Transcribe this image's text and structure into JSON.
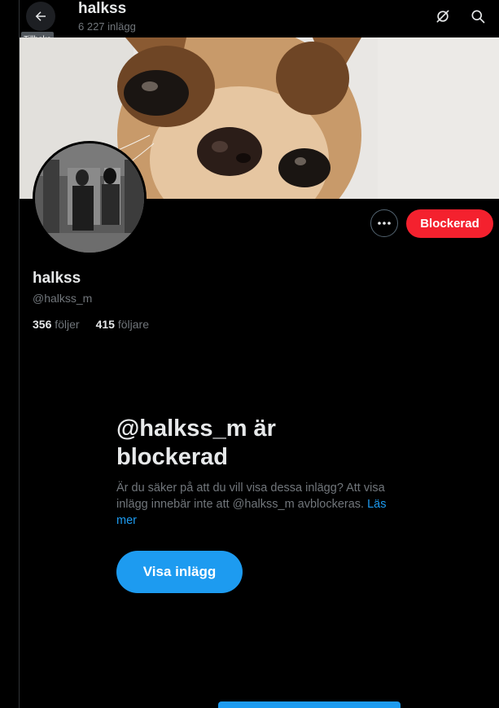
{
  "header": {
    "back_tooltip": "Tillbaka",
    "title": "halkss",
    "post_count": "6 227 inlägg",
    "icons": [
      "back-arrow-icon",
      "grok-icon",
      "search-icon"
    ]
  },
  "profile": {
    "display_name": "halkss",
    "handle": "@halkss_m",
    "following_count": "356",
    "following_label": "följer",
    "followers_count": "415",
    "followers_label": "följare",
    "blocked_button": "Blockerad"
  },
  "blocked_notice": {
    "title": "@halkss_m är blockerad",
    "description": "Är du säker på att du vill visa dessa inlägg? Att visa inlägg innebär inte att @halkss_m avblockeras.",
    "link_text": "Läs mer",
    "show_button": "Visa inlägg"
  },
  "colors": {
    "background": "#000000",
    "accent": "#1d9bf0",
    "blocked": "#f4212e",
    "text_primary": "#e7e9ea",
    "text_secondary": "#71767b"
  }
}
